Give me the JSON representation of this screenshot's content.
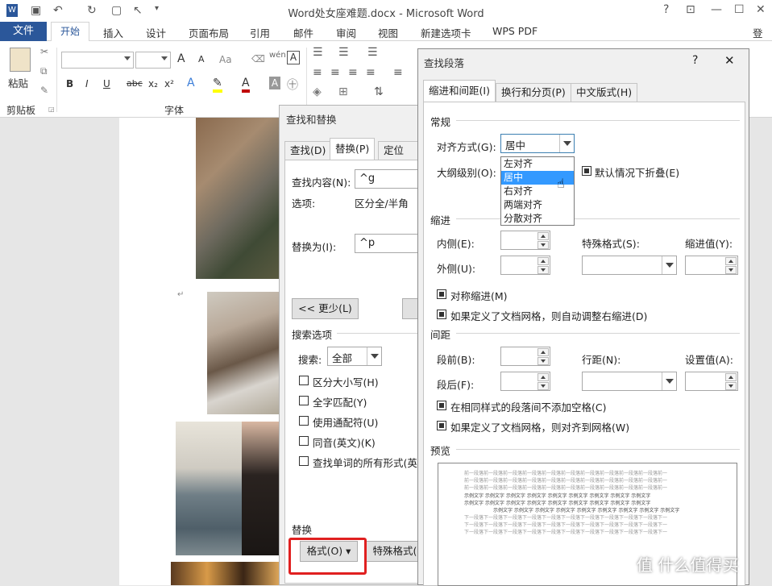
{
  "window": {
    "title": "Word处女座难题.docx - Microsoft Word",
    "help": "?",
    "login": "登录"
  },
  "tabs": {
    "file": "文件",
    "home": "开始",
    "insert": "插入",
    "design": "设计",
    "layout": "页面布局",
    "references": "引用",
    "mailings": "邮件",
    "review": "审阅",
    "view": "视图",
    "newtab": "新建选项卡",
    "wps": "WPS PDF"
  },
  "ribbon": {
    "paste": "粘贴",
    "clipboard": "剪贴板",
    "font": "字体",
    "bold": "B",
    "italic": "I",
    "underline": "U",
    "strike": "abc",
    "sub": "x₂",
    "sup": "x²",
    "grow": "A",
    "shrink": "A",
    "aa": "Aa",
    "wen": "wén",
    "A": "A"
  },
  "find_replace": {
    "title": "查找和替换",
    "tabs": [
      "查找(D)",
      "替换(P)",
      "定位(G)"
    ],
    "find_label": "查找内容(N):",
    "find_value": "^g",
    "options_label": "选项:",
    "options_value": "区分全/半角",
    "replace_label": "替换为(I):",
    "replace_value": "^p",
    "less_button": "<< 更少(L)",
    "search_options": "搜索选项",
    "search_label": "搜索:",
    "search_value": "全部",
    "checks": [
      "区分大小写(H)",
      "全字匹配(Y)",
      "使用通配符(U)",
      "同音(英文)(K)",
      "查找单词的所有形式(英文"
    ],
    "replace_section": "替换",
    "format_button": "格式(O)",
    "special_button": "特殊格式("
  },
  "paragraph": {
    "title": "查找段落",
    "help": "?",
    "tabs": [
      "缩进和间距(I)",
      "换行和分页(P)",
      "中文版式(H)"
    ],
    "general": "常规",
    "align_label": "对齐方式(G):",
    "align_value": "居中",
    "outline_label": "大纲级别(O):",
    "collapse": "默认情况下折叠(E)",
    "align_options": [
      "左对齐",
      "居中",
      "右对齐",
      "两端对齐",
      "分散对齐"
    ],
    "indent": "缩进",
    "inner": "内侧(E):",
    "outer": "外侧(U):",
    "special": "特殊格式(S):",
    "indent_value": "缩进值(Y):",
    "mirror": "对称缩进(M)",
    "auto_right": "如果定义了文档网格，则自动调整右缩进(D)",
    "spacing": "间距",
    "before": "段前(B):",
    "after": "段后(F):",
    "line": "行距(N):",
    "set": "设置值(A):",
    "no_space": "在相同样式的段落间不添加空格(C)",
    "grid": "如果定义了文档网格，则对齐到网格(W)",
    "preview": "预览",
    "preview_prev": "前一段落前一段落前一段落前一段落前一段落前一段落前一段落前一段落前一段落前一段落前一",
    "preview_sample": "示例文字 示例文字 示例文字 示例文字 示例文字 示例文字 示例文字 示例文字 示例文字",
    "preview_next": "下一段落下一段落下一段落下一段落下一段落下一段落下一段落下一段落下一段落下一段落下一"
  },
  "watermark": "值 什么值得买"
}
